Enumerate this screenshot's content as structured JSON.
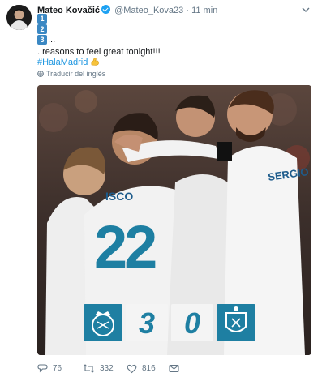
{
  "tweet": {
    "display_name": "Mateo Kovačić",
    "handle": "@Mateo_Kova23",
    "separator": "·",
    "time": "11 min",
    "list": [
      "1",
      "2",
      "3"
    ],
    "ellipsis": "...",
    "text_line": "..reasons to feel great tonight!!!",
    "hashtag": "#HalaMadrid",
    "emoji_icon": "flexed-biceps-icon",
    "translate_label": "Traducir del inglés"
  },
  "photo": {
    "jersey_name": "ISCO",
    "jersey_number": "22",
    "sleeve_name": "SERGIO",
    "score_home": "3",
    "score_away": "0",
    "home_crest": "real-madrid-crest-icon",
    "away_crest": "eibar-crest-icon",
    "colors": {
      "score_teal": "#1e7fa2",
      "shirt": "#f2f2f2",
      "accent_blue": "#1b95e0"
    }
  },
  "actions": {
    "reply_count": "76",
    "retweet_count": "332",
    "like_count": "816"
  }
}
